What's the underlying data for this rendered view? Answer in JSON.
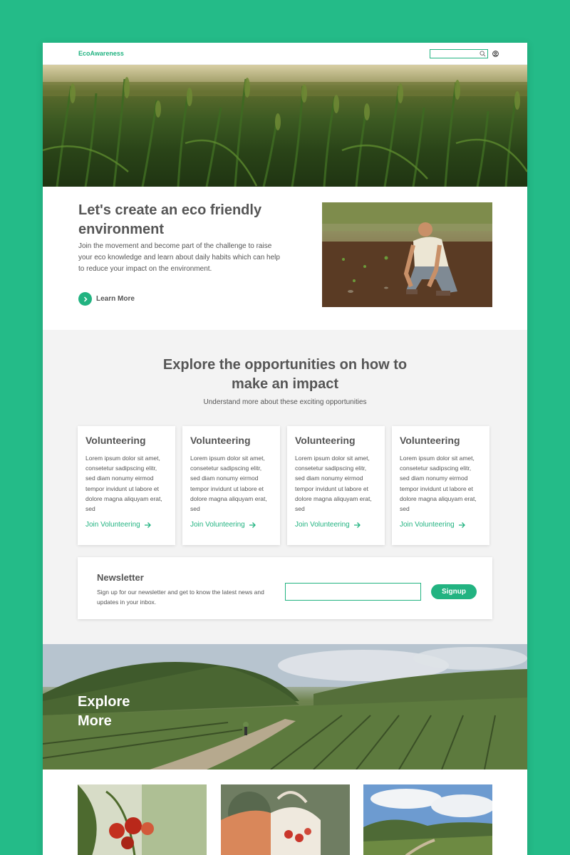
{
  "header": {
    "logo": "EcoAwareness",
    "search_placeholder": ""
  },
  "intro": {
    "title": "Let's create an eco friendly environment",
    "text": "Join the movement and become part of the challenge to raise your eco knowledge and learn about daily habits which can help to reduce your impact on the environment.",
    "cta": "Learn More"
  },
  "opportunities": {
    "title": "Explore the opportunities on how to make an impact",
    "subtitle": "Understand more about these exciting opportunities",
    "cards": [
      {
        "title": "Volunteering",
        "text": "Lorem ipsum dolor sit amet, consetetur sadipscing elitr, sed diam nonumy eirmod tempor invidunt ut labore et dolore magna aliquyam erat, sed",
        "link": "Join Volunteering"
      },
      {
        "title": "Volunteering",
        "text": "Lorem ipsum dolor sit amet, consetetur sadipscing elitr, sed diam nonumy eirmod tempor invidunt ut labore et dolore magna aliquyam erat, sed",
        "link": "Join Volunteering"
      },
      {
        "title": "Volunteering",
        "text": "Lorem ipsum dolor sit amet, consetetur sadipscing elitr, sed diam nonumy eirmod tempor invidunt ut labore et dolore magna aliquyam erat, sed",
        "link": "Join Volunteering"
      },
      {
        "title": "Volunteering",
        "text": "Lorem ipsum dolor sit amet, consetetur sadipscing elitr, sed diam nonumy eirmod tempor invidunt ut labore et dolore magna aliquyam erat, sed",
        "link": "Join Volunteering"
      }
    ]
  },
  "newsletter": {
    "title": "Newsletter",
    "text": "Sign up for our newsletter and get to know the latest news and updates in your inbox.",
    "input_placeholder": "",
    "button": "Signup"
  },
  "explore": {
    "title": "Explore More"
  },
  "colors": {
    "brand": "#22b381",
    "background": "#24bb88",
    "section_bg": "#f3f3f3"
  },
  "icons": [
    "search-icon",
    "user-icon",
    "chevron-right-icon",
    "arrow-right-icon"
  ]
}
